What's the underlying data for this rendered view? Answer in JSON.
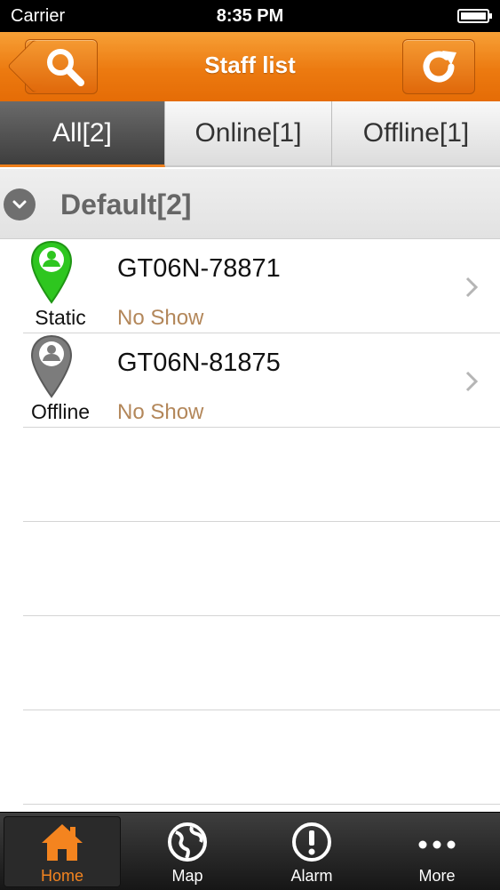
{
  "status_bar": {
    "carrier": "Carrier",
    "time": "8:35 PM"
  },
  "nav": {
    "title": "Staff list"
  },
  "tabs": [
    {
      "label": "All[2]"
    },
    {
      "label": "Online[1]"
    },
    {
      "label": "Offline[1]"
    }
  ],
  "group": {
    "label": "Default[2]"
  },
  "devices": [
    {
      "name": "GT06N-78871",
      "status": "Static",
      "address": "No Show",
      "pin_color": "#2ec61f"
    },
    {
      "name": "GT06N-81875",
      "status": "Offline",
      "address": "No Show",
      "pin_color": "#7c7c7c"
    }
  ],
  "tab_bar": [
    {
      "label": "Home",
      "icon": "home-icon"
    },
    {
      "label": "Map",
      "icon": "globe-icon"
    },
    {
      "label": "Alarm",
      "icon": "alert-icon"
    },
    {
      "label": "More",
      "icon": "more-icon"
    }
  ],
  "colors": {
    "accent": "#ef7f1a",
    "address_text": "#b3875a"
  }
}
